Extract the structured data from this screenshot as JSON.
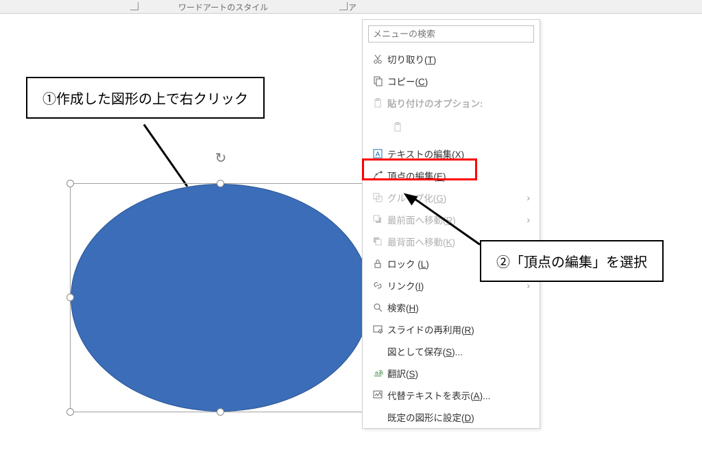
{
  "ribbon": {
    "group_label_center": "ワードアートのスタイル",
    "partial_label": "ア"
  },
  "annotations": {
    "a1": "①作成した図形の上で右クリック",
    "a2": "②「頂点の編集」を選択"
  },
  "shape": {
    "fill": "#3b6db8",
    "border": "#2b5592"
  },
  "context_menu": {
    "search_placeholder": "メニューの検索",
    "items": [
      {
        "icon": "cut-icon",
        "label": "切り取り(T)",
        "mnemonic": "T",
        "enabled": true
      },
      {
        "icon": "copy-icon",
        "label": "コピー(C)",
        "mnemonic": "C",
        "enabled": true
      },
      {
        "icon": "paste-icon",
        "label": "貼り付けのオプション:",
        "enabled": false,
        "bold": true,
        "has_paste_options": true
      },
      {
        "icon": "edit-text-icon",
        "label": "テキストの編集(X)",
        "mnemonic": "X",
        "enabled": true
      },
      {
        "icon": "edit-points-icon",
        "label": "頂点の編集(E)",
        "mnemonic": "E",
        "enabled": true,
        "highlighted": true
      },
      {
        "icon": "group-icon",
        "label": "グループ化(G)",
        "mnemonic": "G",
        "enabled": false,
        "submenu": true
      },
      {
        "icon": "bring-front-icon",
        "label": "最前面へ移動(R)",
        "mnemonic": "R",
        "enabled": false,
        "submenu": true
      },
      {
        "icon": "send-back-icon",
        "label": "最背面へ移動(K)",
        "mnemonic": "K",
        "enabled": false,
        "submenu": true
      },
      {
        "icon": "lock-icon",
        "label": "ロック (L)",
        "mnemonic": "L",
        "enabled": true
      },
      {
        "icon": "link-icon",
        "label": "リンク(I)",
        "mnemonic": "I",
        "enabled": true,
        "submenu": true
      },
      {
        "icon": "search-icon",
        "label": "検索(H)",
        "mnemonic": "H",
        "enabled": true
      },
      {
        "icon": "reuse-slide-icon",
        "label": "スライドの再利用(R)",
        "mnemonic": "R",
        "enabled": true
      },
      {
        "icon": "blank",
        "label": "図として保存(S)...",
        "mnemonic": "S",
        "enabled": true
      },
      {
        "icon": "translate-icon",
        "label": "翻訳(S)",
        "mnemonic": "S",
        "enabled": true
      },
      {
        "icon": "alt-text-icon",
        "label": "代替テキストを表示(A)...",
        "mnemonic": "A",
        "enabled": true
      },
      {
        "icon": "blank",
        "label": "既定の図形に設定(D)",
        "mnemonic": "D",
        "enabled": true
      }
    ]
  }
}
